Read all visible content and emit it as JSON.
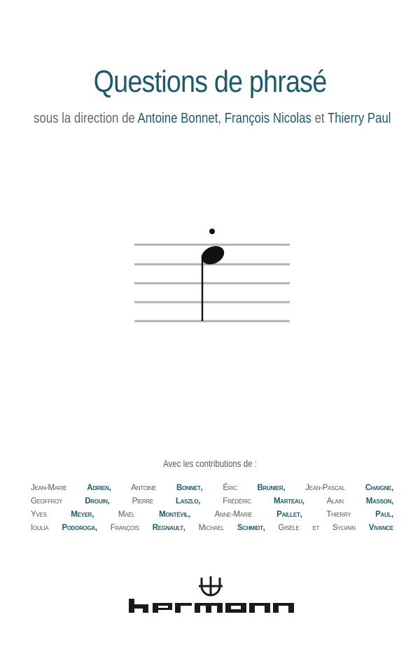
{
  "title": "Questions de phrasé",
  "subtitle": {
    "prefix": "sous la direction de",
    "editor1": "Antoine Bonnet,",
    "editor2": "François Nicolas",
    "connector": "et",
    "editor3": "Thierry Paul"
  },
  "contributions": {
    "heading": "Avec les contributions de :",
    "lines": [
      [
        {
          "first": "Jean-Marie",
          "last": "Adrien,"
        },
        {
          "first": "Antoine",
          "last": "Bonnet,"
        },
        {
          "first": "Éric",
          "last": "Brunier,"
        },
        {
          "first": "Jean-Pascal",
          "last": "Chaigne,"
        }
      ],
      [
        {
          "first": "Geoffroy",
          "last": "Drouin,"
        },
        {
          "first": "Pierre",
          "last": "Laszlo,"
        },
        {
          "first": "Frédéric",
          "last": "Marteau,"
        },
        {
          "first": "Alain",
          "last": "Masson,"
        }
      ],
      [
        {
          "first": "Yves",
          "last": "Meyer,"
        },
        {
          "first": "Maël",
          "last": "Montévil,"
        },
        {
          "first": "Anne-Marie",
          "last": "Paillet,"
        },
        {
          "first": "Thierry",
          "last": "Paul,"
        }
      ],
      [
        {
          "first": "Ioulia",
          "last": "Podoroga,"
        },
        {
          "first": "François",
          "last": "Regnault,"
        },
        {
          "first": "Michael",
          "last": "Schmidt,"
        },
        {
          "first": "Gisèle",
          "last": ""
        },
        {
          "first": "et",
          "last": ""
        },
        {
          "first": "Sylvain",
          "last": "Vivance"
        }
      ]
    ]
  },
  "publisher": "hermann",
  "colors": {
    "accent": "#1f5a6b",
    "text_gray": "#666666",
    "staff_line": "#b0b0b0"
  }
}
